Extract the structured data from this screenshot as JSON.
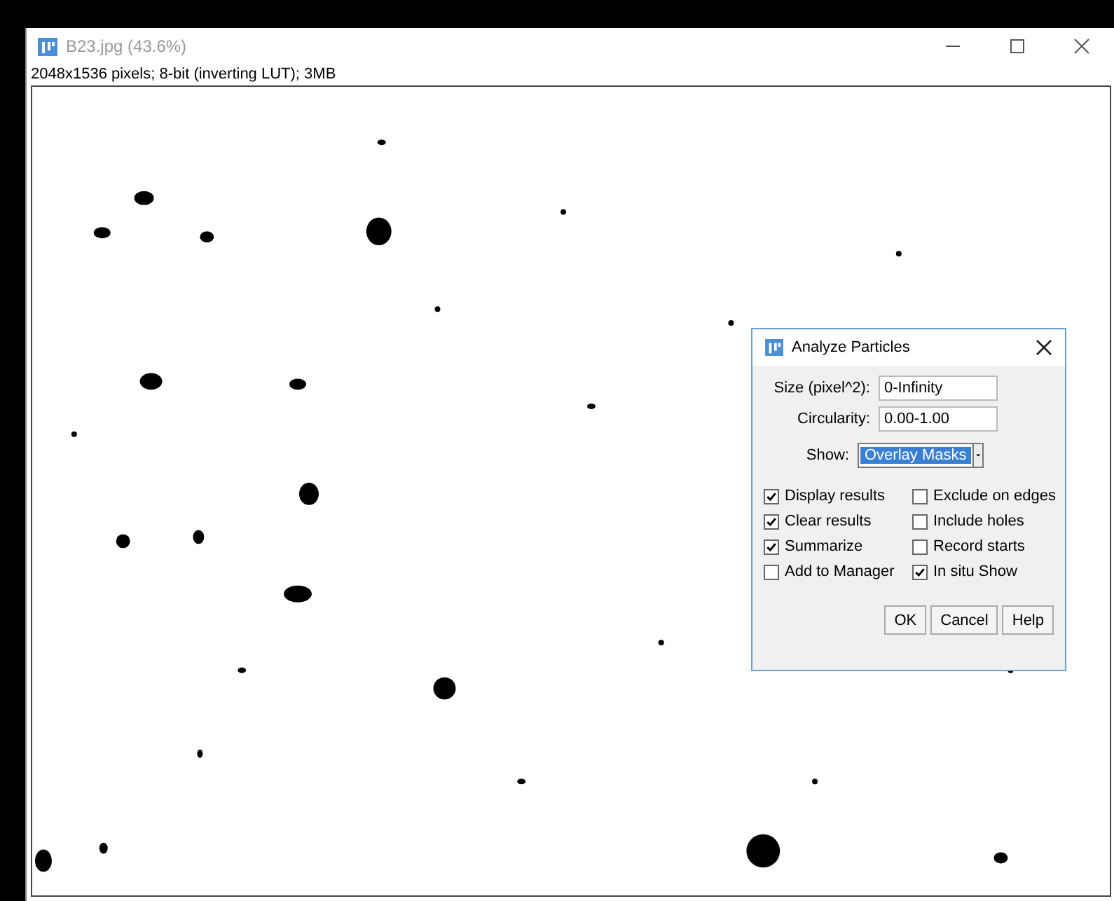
{
  "window": {
    "title": "B23.jpg (43.6%)",
    "info": "2048x1536 pixels; 8-bit (inverting LUT); 3MB"
  },
  "dialog": {
    "title": "Analyze Particles",
    "fields": [
      {
        "label": "Size (pixel^2):",
        "value": "0-Infinity"
      },
      {
        "label": "Circularity:",
        "value": "0.00-1.00"
      }
    ],
    "show": {
      "label": "Show:",
      "value": "Overlay Masks"
    },
    "options": [
      {
        "label": "Display results",
        "checked": true
      },
      {
        "label": "Exclude on edges",
        "checked": false
      },
      {
        "label": "Clear results",
        "checked": true
      },
      {
        "label": "Include holes",
        "checked": false
      },
      {
        "label": "Summarize",
        "checked": true
      },
      {
        "label": "Record starts",
        "checked": false
      },
      {
        "label": "Add to Manager",
        "checked": false
      },
      {
        "label": "In situ Show",
        "checked": true
      }
    ],
    "buttons": [
      "OK",
      "Cancel",
      "Help"
    ]
  }
}
